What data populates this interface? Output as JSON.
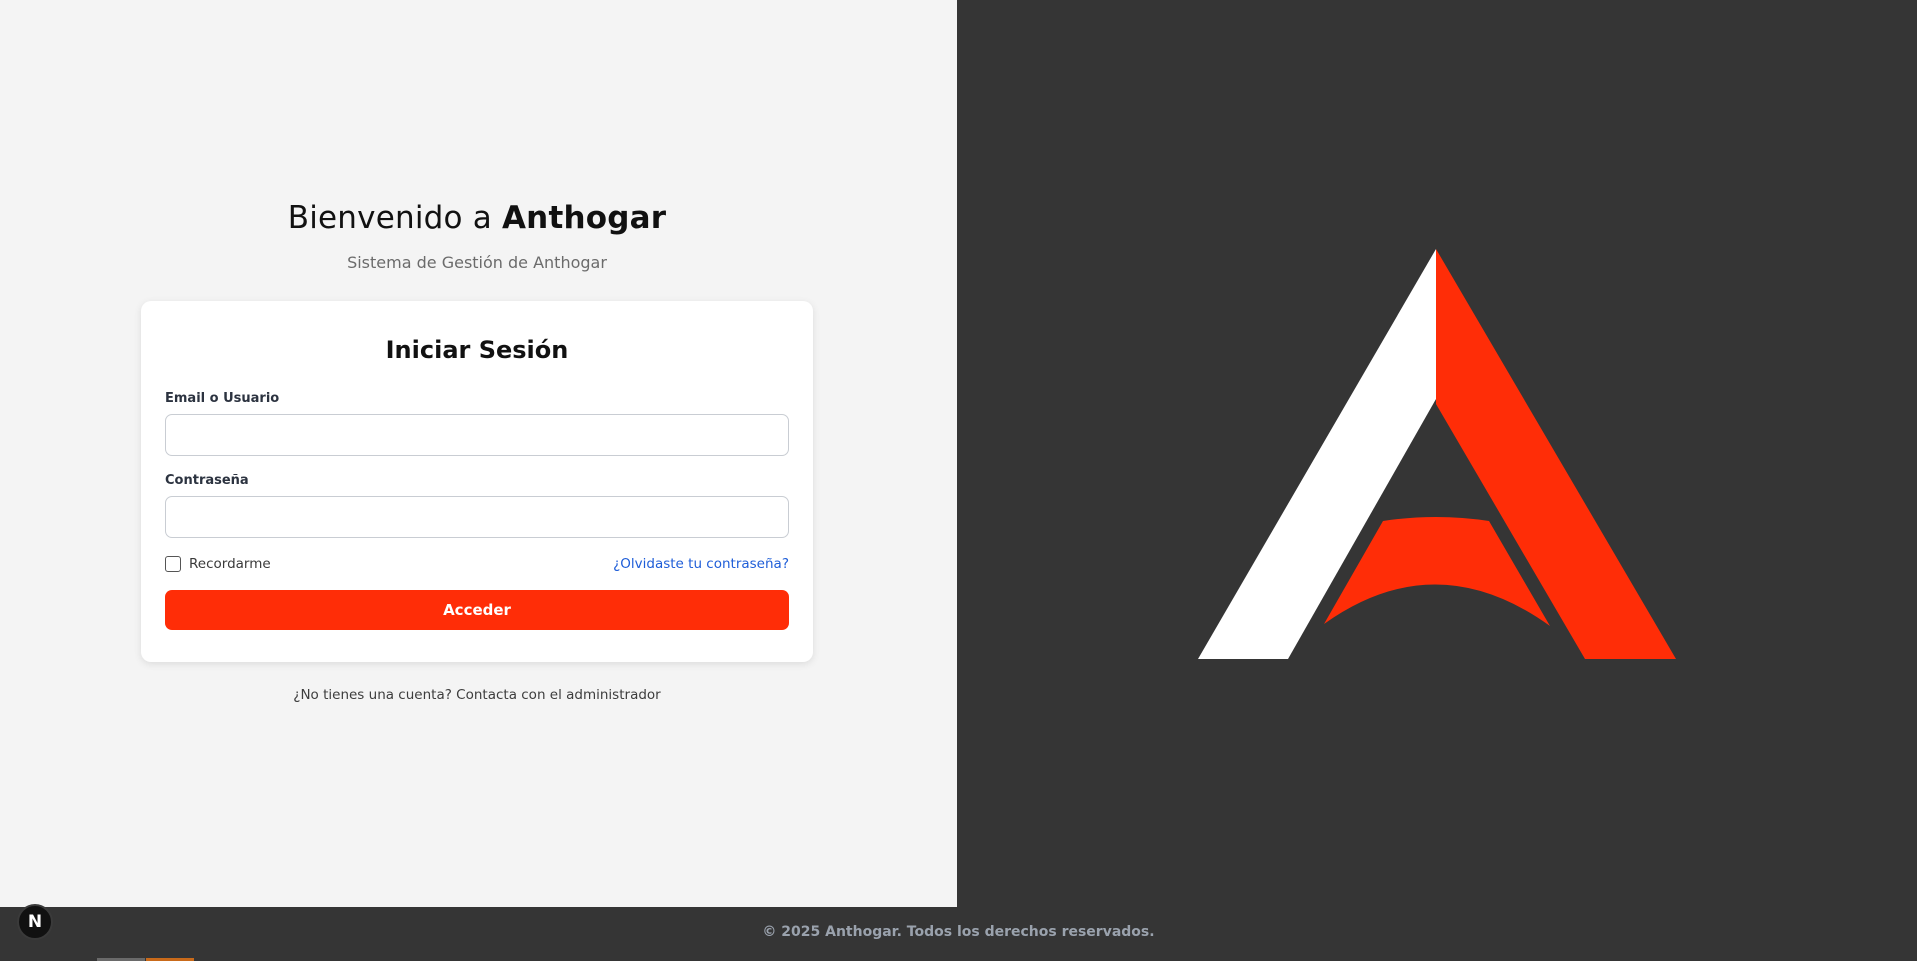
{
  "header": {
    "welcome_prefix": "Bienvenido a ",
    "brand_name": "Anthogar",
    "subtitle": "Sistema de Gestión de Anthogar"
  },
  "login_card": {
    "title": "Iniciar Sesión",
    "email_label": "Email o Usuario",
    "email_value": "",
    "password_label": "Contraseña",
    "password_value": "",
    "remember_label": "Recordarme",
    "remember_checked": false,
    "forgot_link": "¿Olvidaste tu contraseña?",
    "submit_label": "Acceder"
  },
  "signup_note": "¿No tienes una cuenta? Contacta con el administrador",
  "footer": {
    "copyright": "© 2025 Anthogar. Todos los derechos reservados."
  },
  "dev_badge": {
    "letter": "N"
  },
  "logo": {
    "icon": "anthogar-a-logo-icon",
    "primary_color": "#ff2d07",
    "secondary_color": "#ffffff"
  },
  "colors": {
    "accent": "#ff2d07",
    "panel_dark": "#353535",
    "panel_light": "#f4f4f4",
    "link": "#1f5ed8"
  }
}
